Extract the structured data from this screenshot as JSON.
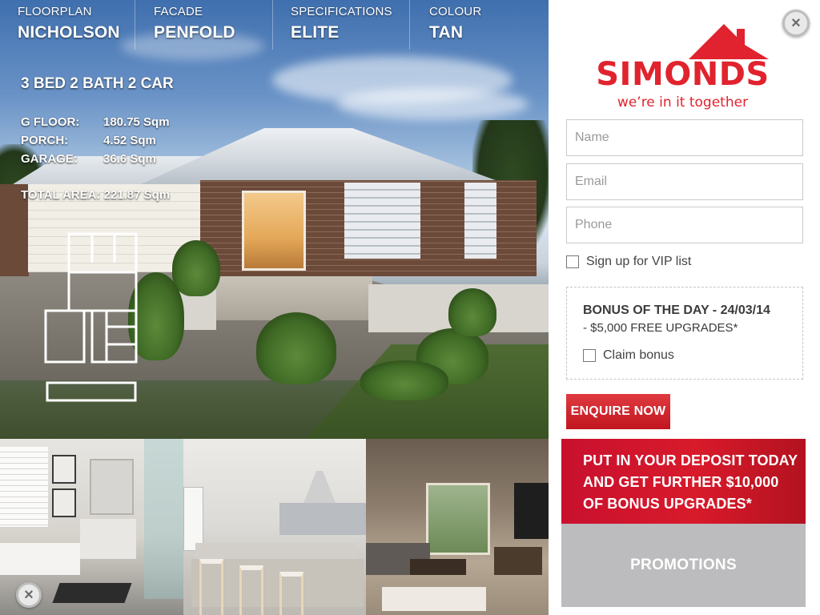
{
  "specs": [
    {
      "label": "FLOORPLAN",
      "value": "NICHOLSON"
    },
    {
      "label": "FACADE",
      "value": "PENFOLD"
    },
    {
      "label": "SPECIFICATIONS",
      "value": "ELITE"
    },
    {
      "label": "COLOUR",
      "value": "TAN"
    }
  ],
  "home": {
    "summary": "3 BED 2 BATH 2 CAR",
    "areas": [
      {
        "label": "G FLOOR:",
        "value": "180.75 Sqm"
      },
      {
        "label": "PORCH:",
        "value": "4.52 Sqm"
      },
      {
        "label": "GARAGE:",
        "value": "36.6 Sqm"
      }
    ],
    "total": "TOTAL AREA: 221.87 Sqm"
  },
  "brand": {
    "name": "SIMONDS",
    "tagline": "we’re in it together",
    "color": "#e0232e"
  },
  "form": {
    "name_placeholder": "Name",
    "email_placeholder": "Email",
    "phone_placeholder": "Phone",
    "vip_label": "Sign up for VIP list"
  },
  "bonus": {
    "title": "BONUS OF THE DAY - 24/03/14",
    "detail": "- $5,000 FREE UPGRADES*",
    "claim_label": "Claim bonus"
  },
  "actions": {
    "enquire_label": "ENQUIRE NOW",
    "deposit_lines": [
      "PUT IN YOUR DEPOSIT TODAY",
      "AND GET FURTHER $10,000",
      "OF BONUS UPGRADES*"
    ],
    "promotions_label": "PROMOTIONS"
  },
  "icons": {
    "close": "close-icon"
  }
}
